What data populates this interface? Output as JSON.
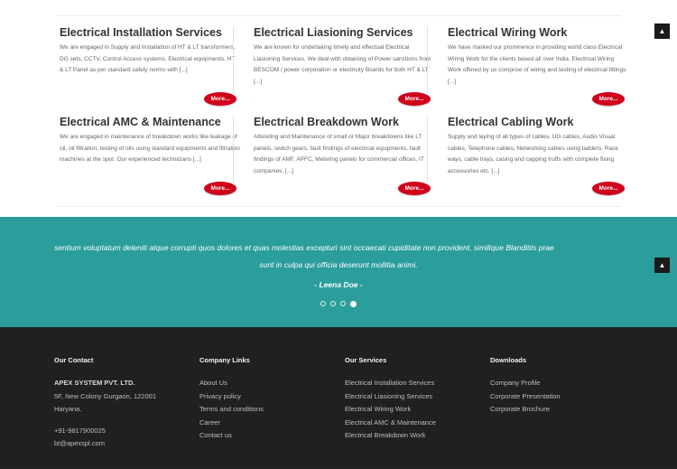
{
  "services": [
    {
      "title": "Electrical Installation Services",
      "desc": "We are engaged in Supply and Installation of HT & LT transformers, DG sets, CCTV, Control Access systems, Electrical equipments, HT & LT Panel as per standard safety norms with [...]",
      "more": "More..."
    },
    {
      "title": "Electrical Liasioning Services",
      "desc": "We are known for undertaking timely and effectual Electrical Liasioning Services. We deal with obtaining of Power sanctions from BESCOM / power corporation or electricity Boards for both HT & LT [...]",
      "more": "More..."
    },
    {
      "title": "Electrical Wiring Work",
      "desc": "We have marked our prominence in providing world class Electrical Wiring Work for the clients based all over India. Electrical Wiring Work offered by us comprise of wiring and testing of electrical fittings [...]",
      "more": "More..."
    },
    {
      "title": "Electrical AMC & Maintenance",
      "desc": "We are engaged in maintenance of breakdown works like leakage of oil, oil filtration, testing of oils using standard equipments and filtration machines at the spot. Our experienced technicians [...]",
      "more": "More..."
    },
    {
      "title": "Electrical Breakdown Work",
      "desc": "Attending and Maintenance of small or Major breakdowns like LT panels, switch gears, fault findings of electrical equipments, fault findings of AMF, APFC, Metering panels for commercial offices, IT companies, [...]",
      "more": "More..."
    },
    {
      "title": "Electrical Cabling Work",
      "desc": "Supply and laying of all types of cables, UG cables, Audio Visual cables, Telephone cables, Networking cables using ladders, Race ways, cable trays, casing and capping truffs with complete fixing accessories etc. [...]",
      "more": "More..."
    }
  ],
  "testimonial": {
    "line1": "sentium voluptatum deleniti atque corrupti quos dolores et quas molestias excepturi sint occaecati cupiditate non provident, similique       Blanditiis prae",
    "line2": "sunt in culpa qui officia deserunt mollitia animi.",
    "author": "- Leena Doe -",
    "active_slide": 4,
    "slide_count": 4
  },
  "scroll_top": {
    "icon": "chevron-up-icon",
    "glyph": "▲"
  },
  "footer": {
    "contact": {
      "heading": "Our Contact",
      "company": "APEX SYSTEM PVT. LTD.",
      "address1": "5F, New Colony Gurgaon, 122001",
      "address2": "Haryana.",
      "phone": "+91-9817900025",
      "email": "bt@apexspl.com"
    },
    "company_links": {
      "heading": "Company Links",
      "items": [
        "About Us",
        "Privacy policy",
        "Terms and conditions",
        "Career",
        "Contact us"
      ]
    },
    "our_services": {
      "heading": "Our Services",
      "items": [
        "Electrical Installation Services",
        "Electrical Liasioning Services",
        "Electrical Wiring Work",
        "Electrical AMC & Maintenance",
        "Electrical Breakdown Work"
      ]
    },
    "downloads": {
      "heading": "Downloads",
      "items": [
        "Company Profile",
        "Corporate Presentation",
        "Corporate Brochure"
      ]
    }
  },
  "colors": {
    "accent_teal": "#2a9d9c",
    "button_red": "#d0021b",
    "footer_bg": "#1f1f1f"
  }
}
